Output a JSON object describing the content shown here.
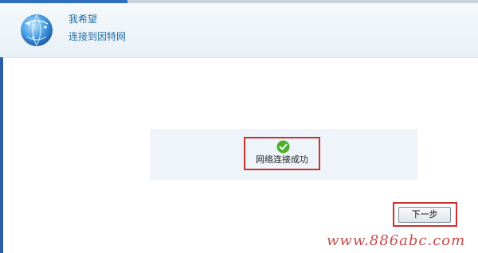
{
  "wizard": {
    "title": "我希望",
    "subtitle": "连接到因特网"
  },
  "status": {
    "icon": "checkmark-icon",
    "message": "网络连接成功"
  },
  "actions": {
    "next_label": "下一步"
  },
  "watermark": {
    "text": "www.886abc.com"
  },
  "colors": {
    "highlight_border": "#c8322f",
    "accent": "#1f6fa8",
    "success": "#4caf2a"
  }
}
